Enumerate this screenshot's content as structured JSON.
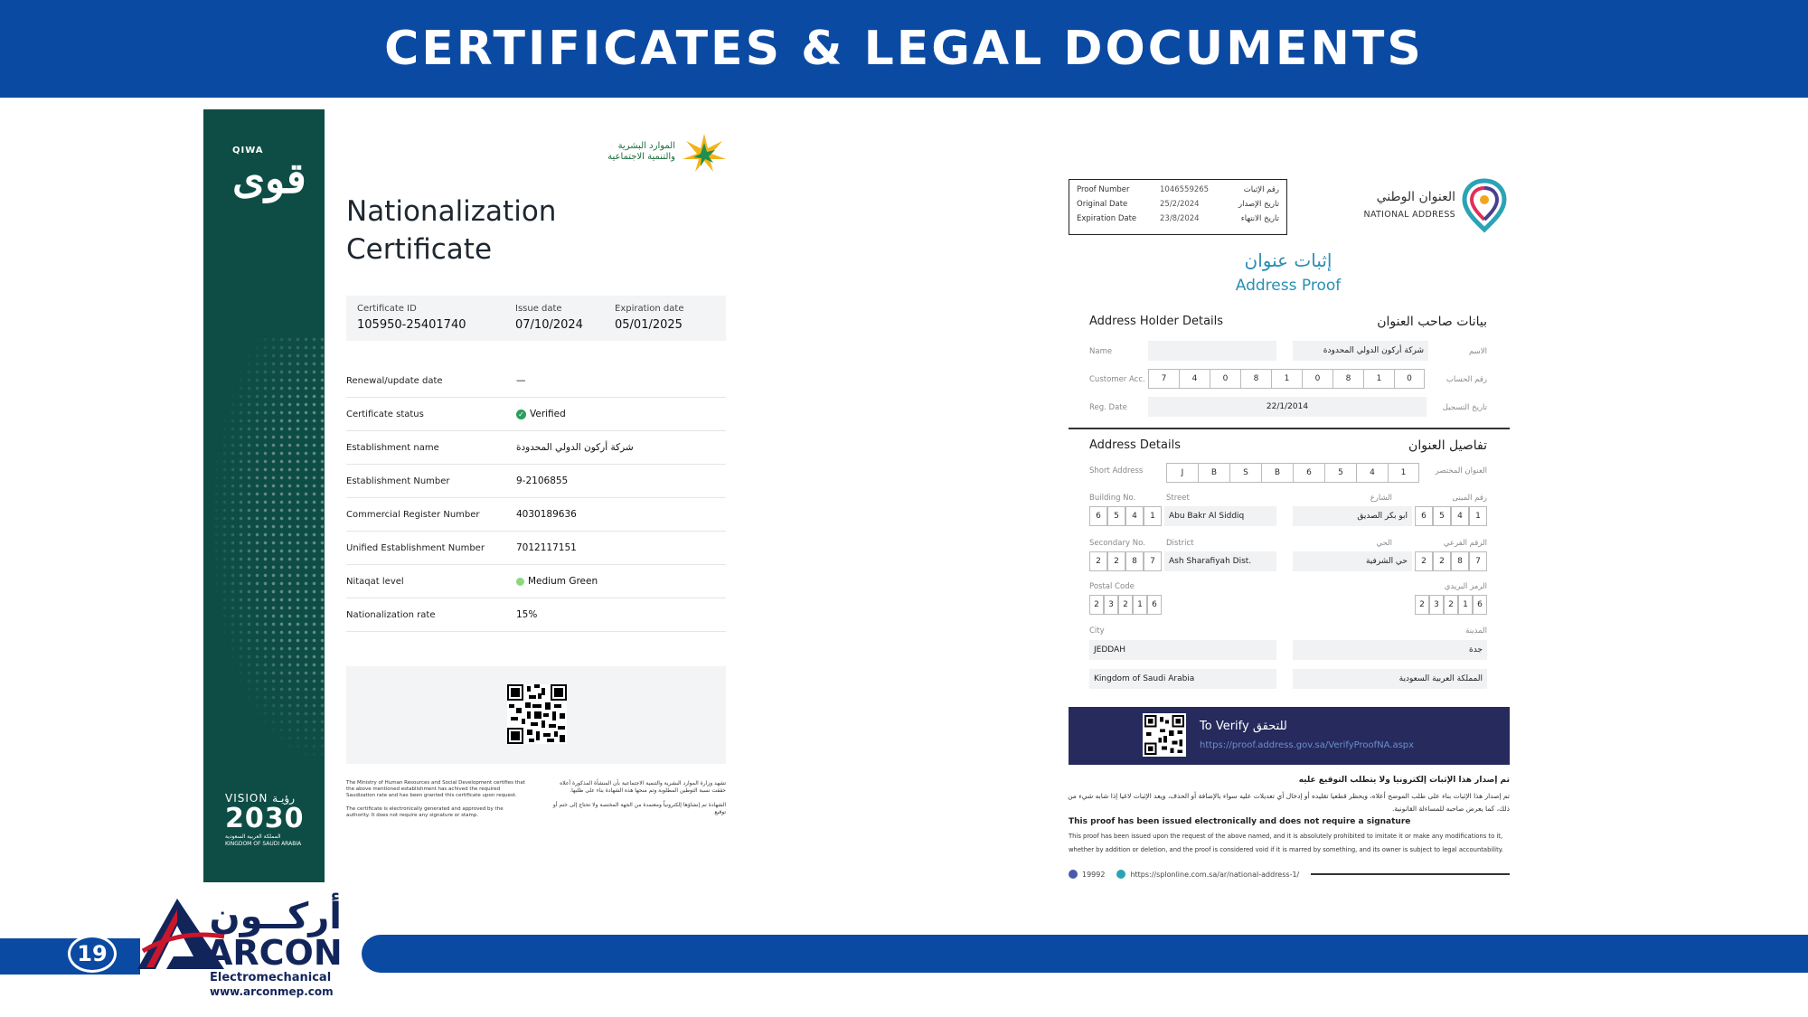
{
  "header": {
    "title": "CERTIFICATES & LEGAL DOCUMENTS"
  },
  "nationalization": {
    "strip_brand_small": "QIWA",
    "strip_brand_logo": "قوى",
    "vision_top": "VISION رؤيـة",
    "vision_year": "2030",
    "vision_sub1": "المملكة العربية السعودية",
    "vision_sub2": "KINGDOM OF SAUDI ARABIA",
    "ministry_logo_ar_1": "الموارد البشرية",
    "ministry_logo_ar_2": "والتنمية الاجتماعية",
    "title_line1": "Nationalization",
    "title_line2": "Certificate",
    "id_fields": [
      {
        "label": "Certificate ID",
        "value": "105950-25401740"
      },
      {
        "label": "Issue date",
        "value": "07/10/2024"
      },
      {
        "label": "Expiration date",
        "value": "05/01/2025"
      }
    ],
    "rows": [
      {
        "label": "Renewal/update date",
        "value": "—"
      },
      {
        "label": "Certificate status",
        "value": "Verified"
      },
      {
        "label": "Establishment name",
        "value": "شركة أركون الدولي المحدودة"
      },
      {
        "label": "Establishment Number",
        "value": "9-2106855"
      },
      {
        "label": "Commercial Register Number",
        "value": "4030189636"
      },
      {
        "label": "Unified Establishment Number",
        "value": "7012117151"
      },
      {
        "label": "Nitaqat level",
        "value": "Medium Green"
      },
      {
        "label": "Nationalization rate",
        "value": "15%"
      }
    ],
    "footer_en_1": "The Ministry of Human Resources and Social Development certifies that the above mentioned establishment has achived the required Saudization rate and has been granted this certificate upon request.",
    "footer_en_2": "The certificate is electronically generated and approved by the authority. It does not require any signature or stamp.",
    "footer_ar_1": "تشهد وزارة الموارد البشرية والتنمية الاجتماعية بأن المنشأة المذكورة أعلاه حققت نسبة التوطين المطلوبة وتم منحها هذه الشهادة بناء على طلبها.",
    "footer_ar_2": "الشهادة تم إنشاؤها إلكترونياً ومعتمدة من الجهة المختصة ولا تحتاج إلى ختم أو توقيع"
  },
  "address_proof": {
    "proof_rows": [
      {
        "en": "Proof Number",
        "val": "1046559265",
        "ar": "رقم الإثبات"
      },
      {
        "en": "Original Date",
        "val": "25/2/2024",
        "ar": "تاريخ الإصدار"
      },
      {
        "en": "Expiration Date",
        "val": "23/8/2024",
        "ar": "تاريخ الانتهاء"
      }
    ],
    "na_logo_ar": "العنوان الوطني",
    "na_logo_en": "NATIONAL ADDRESS",
    "title_ar": "إثبات عنوان",
    "title_en": "Address Proof",
    "holder_en": "Address Holder Details",
    "holder_ar": "بيانات صاحب العنوان",
    "name_label_en": "Name",
    "name_label_ar": "الاسم",
    "name_value": "شركة أركون الدولي المحدودة",
    "cust_label_en": "Customer Acc.",
    "cust_label_ar": "رقم الحساب",
    "cust_digits": [
      "7",
      "4",
      "0",
      "8",
      "1",
      "0",
      "8",
      "1",
      "0"
    ],
    "reg_label_en": "Reg. Date",
    "reg_label_ar": "تاريخ التسجيل",
    "reg_value": "22/1/2014",
    "details_en": "Address Details",
    "details_ar": "تفاصيل العنوان",
    "short_label_en": "Short Address",
    "short_label_ar": "العنوان المختصر",
    "short_cells": [
      "J",
      "B",
      "S",
      "B",
      "6",
      "5",
      "4",
      "1"
    ],
    "building_en": "Building No.",
    "street_en": "Street",
    "street_ar_lbl": "الشارع",
    "building_ar": "رقم المبنى",
    "building_digits": [
      "6",
      "5",
      "4",
      "1"
    ],
    "street_value": "Abu Bakr Al Siddiq",
    "street_value_ar": "ابو بكر الصديق",
    "secondary_en": "Secondary No.",
    "district_en": "District",
    "district_ar_lbl": "الحي",
    "secondary_ar": "الرقم الفرعي",
    "secondary_digits": [
      "2",
      "2",
      "8",
      "7"
    ],
    "district_value": "Ash Sharafiyah Dist.",
    "district_value_ar": "حي الشرفية",
    "postal_en": "Postal Code",
    "postal_ar": "الرمز البريدي",
    "postal_digits": [
      "2",
      "3",
      "2",
      "1",
      "6"
    ],
    "city_en": "City",
    "city_ar": "المدينة",
    "city_value": "JEDDAH",
    "city_value_ar": "جدة",
    "country_value": "Kingdom of Saudi Arabia",
    "country_value_ar": "المملكة العربية السعودية",
    "verify_title": "To Verify للتحقق",
    "verify_url": "https://proof.address.gov.sa/VerifyProofNA.aspx",
    "note_ar_head": "تم إصدار هذا الإثبات إلكترونيا ولا يتطلب التوقيع عليه",
    "note_ar_body": "تم إصدار هذا الإثبات بناء على طلب الموضح أعلاه، ويحظر قطعيا تقليده أو إدخال أي تعديلات عليه سواء بالإضافة أو الحذف، ويعد الإثبات لاغيا إذا شابه شيء من ذلك، كما يعرض صاحبه للمساءلة القانونية.",
    "note_en_head": "This proof has been issued electronically and does not require a signature",
    "note_en_body": "This proof has been issued upon the request of the above named, and it is absolutely prohibited to imitate it or make any modifications to it, whether by addition or deletion, and the proof is considered void if it is marred by something, and its owner is subject to legal accountability.",
    "foot_phone": "19992",
    "foot_url": "https://splonline.com.sa/ar/national-address-1/"
  },
  "footer": {
    "page_number": "19",
    "brand_ar": "أركــون",
    "brand_en": "ARCON",
    "brand_sub": "Electromechanical",
    "brand_web": "www.arconmep.com"
  },
  "colors": {
    "header_blue": "#0b4aa2",
    "qiwa_green": "#0e4d45",
    "proof_navy": "#262a5c",
    "proof_accent": "#2a8fb3"
  }
}
